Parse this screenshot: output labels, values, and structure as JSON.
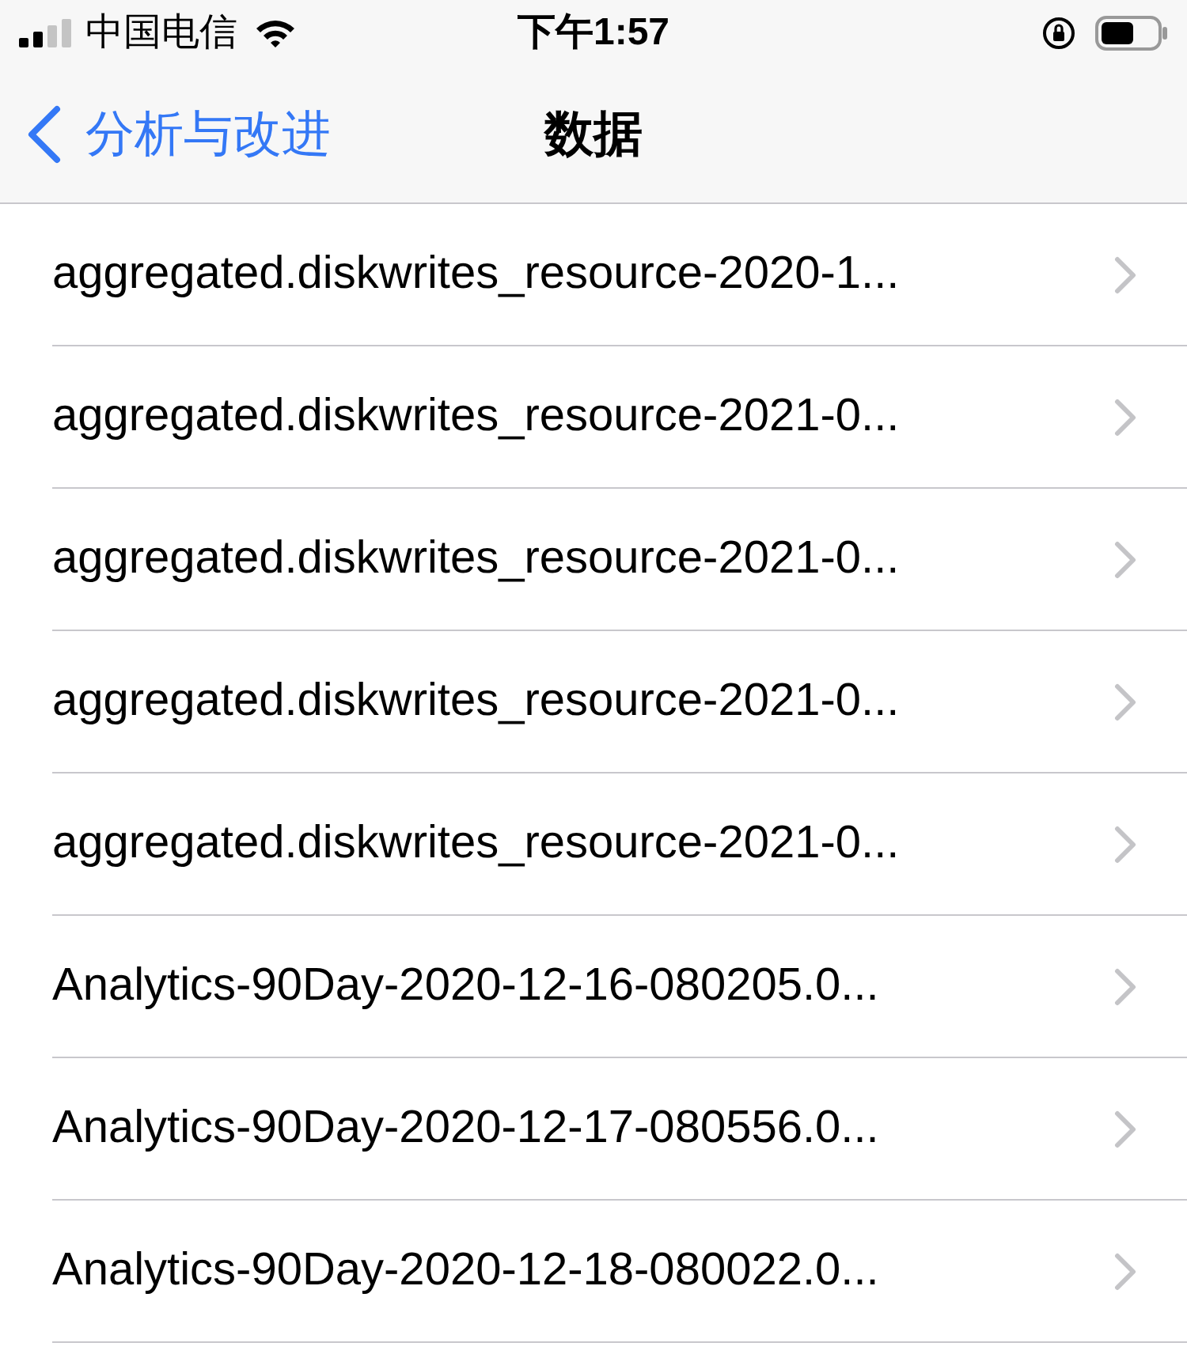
{
  "status_bar": {
    "carrier": "中国电信",
    "time": "下午1:57"
  },
  "nav": {
    "back": "分析与改进",
    "title": "数据"
  },
  "rows": [
    {
      "label": "aggregated.diskwrites_resource-2020-1..."
    },
    {
      "label": "aggregated.diskwrites_resource-2021-0..."
    },
    {
      "label": "aggregated.diskwrites_resource-2021-0..."
    },
    {
      "label": "aggregated.diskwrites_resource-2021-0..."
    },
    {
      "label": "aggregated.diskwrites_resource-2021-0..."
    },
    {
      "label": "Analytics-90Day-2020-12-16-080205.0..."
    },
    {
      "label": "Analytics-90Day-2020-12-17-080556.0..."
    },
    {
      "label": "Analytics-90Day-2020-12-18-080022.0..."
    }
  ]
}
